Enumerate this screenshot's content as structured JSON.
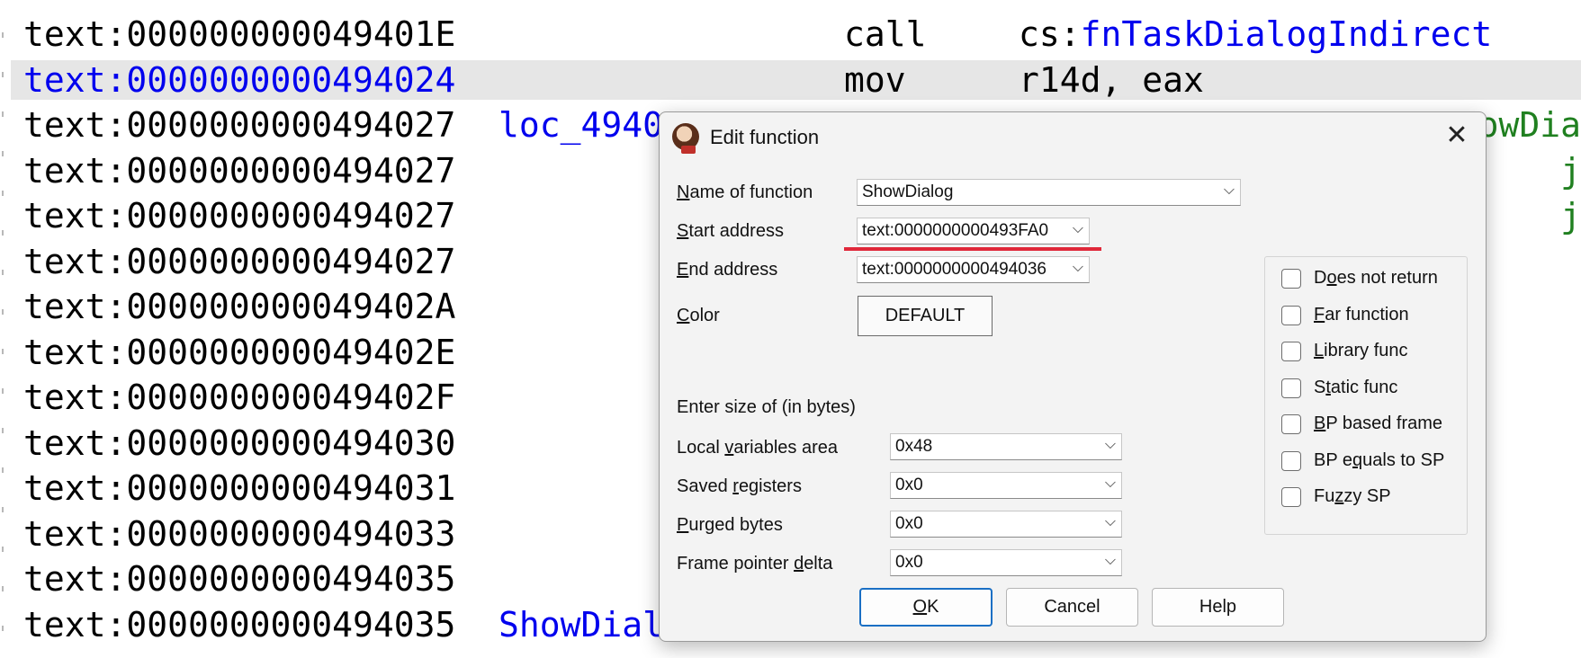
{
  "listing": {
    "lines": [
      {
        "addr": "text:000000000049401E",
        "label": "",
        "mnemonic": "call",
        "operand_prefix": "cs:",
        "operand_fn": "fnTaskDialogIndirect",
        "comment": "",
        "highlighted": false
      },
      {
        "addr": "text:0000000000494024",
        "label": "",
        "mnemonic": "mov",
        "operand_prefix": "r14d, eax",
        "operand_fn": "",
        "comment": "",
        "highlighted": true
      },
      {
        "addr": "text:0000000000494027",
        "label": "loc_4940",
        "mnemonic": "",
        "operand_prefix": "",
        "operand_fn": "",
        "comment": "owDia",
        "highlighted": false
      },
      {
        "addr": "text:0000000000494027",
        "label": "",
        "mnemonic": "",
        "operand_prefix": "",
        "operand_fn": "",
        "comment": "j",
        "highlighted": false
      },
      {
        "addr": "text:0000000000494027",
        "label": "",
        "mnemonic": "",
        "operand_prefix": "",
        "operand_fn": "",
        "comment": "j",
        "highlighted": false
      },
      {
        "addr": "text:0000000000494027",
        "label": "",
        "mnemonic": "",
        "operand_prefix": "",
        "operand_fn": "",
        "comment": "",
        "highlighted": false
      },
      {
        "addr": "text:000000000049402A",
        "label": "",
        "mnemonic": "",
        "operand_prefix": "",
        "operand_fn": "",
        "comment": "",
        "highlighted": false
      },
      {
        "addr": "text:000000000049402E",
        "label": "",
        "mnemonic": "",
        "operand_prefix": "",
        "operand_fn": "",
        "comment": "",
        "highlighted": false
      },
      {
        "addr": "text:000000000049402F",
        "label": "",
        "mnemonic": "",
        "operand_prefix": "",
        "operand_fn": "",
        "comment": "",
        "highlighted": false
      },
      {
        "addr": "text:0000000000494030",
        "label": "",
        "mnemonic": "",
        "operand_prefix": "",
        "operand_fn": "",
        "comment": "",
        "highlighted": false
      },
      {
        "addr": "text:0000000000494031",
        "label": "",
        "mnemonic": "",
        "operand_prefix": "",
        "operand_fn": "",
        "comment": "",
        "highlighted": false
      },
      {
        "addr": "text:0000000000494033",
        "label": "",
        "mnemonic": "",
        "operand_prefix": "",
        "operand_fn": "",
        "comment": "",
        "highlighted": false
      },
      {
        "addr": "text:0000000000494035",
        "label": "",
        "mnemonic": "",
        "operand_prefix": "",
        "operand_fn": "",
        "comment": "",
        "highlighted": false
      },
      {
        "addr": "text:0000000000494035",
        "label": "ShowDial",
        "mnemonic": "",
        "operand_prefix": "",
        "operand_fn": "",
        "comment": "",
        "highlighted": false
      }
    ]
  },
  "dialog": {
    "title": "Edit function",
    "close_glyph": "✕",
    "name_label": {
      "pre": "",
      "u": "N",
      "post": "ame of function"
    },
    "name_value": "ShowDialog",
    "start_label": {
      "pre": "",
      "u": "S",
      "post": "tart address"
    },
    "start_value": "text:0000000000493FA0",
    "end_label": {
      "pre": "",
      "u": "E",
      "post": "nd address"
    },
    "end_value": "text:0000000000494036",
    "color_label": {
      "pre": "",
      "u": "C",
      "post": "olor"
    },
    "color_button": "DEFAULT",
    "size_heading": "Enter size of (in bytes)",
    "local_label": {
      "pre": "Local ",
      "u": "v",
      "post": "ariables area"
    },
    "local_value": "0x48",
    "saved_label": {
      "pre": "Saved ",
      "u": "r",
      "post": "egisters"
    },
    "saved_value": "0x0",
    "purged_label": {
      "pre": "",
      "u": "P",
      "post": "urged bytes"
    },
    "purged_value": "0x0",
    "fpd_label": {
      "pre": "Frame pointer ",
      "u": "d",
      "post": "elta"
    },
    "fpd_value": "0x0",
    "chevron": "⌵",
    "flags": [
      {
        "pre": "D",
        "u": "o",
        "post": "es not return",
        "checked": false
      },
      {
        "pre": "",
        "u": "F",
        "post": "ar function",
        "checked": false
      },
      {
        "pre": "",
        "u": "L",
        "post": "ibrary func",
        "checked": false
      },
      {
        "pre": "S",
        "u": "t",
        "post": "atic func",
        "checked": false
      },
      {
        "pre": "",
        "u": "B",
        "post": "P based frame",
        "checked": false
      },
      {
        "pre": "BP e",
        "u": "q",
        "post": "uals to SP",
        "checked": false
      },
      {
        "pre": "Fu",
        "u": "z",
        "post": "zy SP",
        "checked": false
      }
    ],
    "ok": {
      "pre": "",
      "u": "O",
      "post": "K"
    },
    "cancel": "Cancel",
    "help": "Help"
  }
}
